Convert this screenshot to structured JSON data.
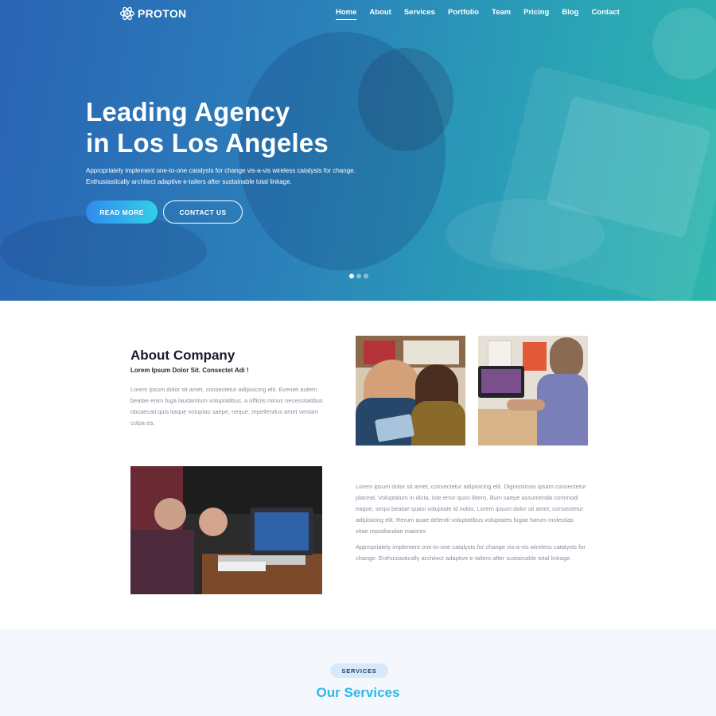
{
  "brand": {
    "name": "PROTON",
    "icon": "atom-icon"
  },
  "nav": {
    "items": [
      {
        "label": "Home",
        "active": true
      },
      {
        "label": "About",
        "active": false
      },
      {
        "label": "Services",
        "active": false
      },
      {
        "label": "Portfolio",
        "active": false
      },
      {
        "label": "Team",
        "active": false
      },
      {
        "label": "Pricing",
        "active": false
      },
      {
        "label": "Blog",
        "active": false
      },
      {
        "label": "Contact",
        "active": false
      }
    ]
  },
  "hero": {
    "title_line1": "Leading Agency",
    "title_line2": "in Los Los Angeles",
    "subtitle_line1": "Appropriately implement one-to-one catalysts for change vis-a-vis wireless catalysts for change.",
    "subtitle_line2": "Enthusiastically architect adaptive e-tailers after sustainable total linkage.",
    "primary_button": "READ MORE",
    "secondary_button": "CONTACT US",
    "slides": 3,
    "active_slide": 1
  },
  "about": {
    "title": "About Company",
    "subtitle": "Lorem Ipsum Dolor Sit. Consectet Adi !",
    "text": "Lorem ipsum dolor sit amet, consectetur adipisicing elit. Eveniet autem beatae enim fuga laudantium voluptatibus, a officiis minus necessitatibus obcaecati quis itaque voluptas saepe, neque, repellendus amet veniam culpa ea.",
    "detail_text1": "Lorem ipsum dolor sit amet, consectetur adipisicing elit. Dignissimos ipsam consectetur placeat. Voluptatum in dicta, iste error quos libero, illum saepe assumenda commodi eaque, sequi beatae quasi voluptate id nobis. Lorem ipsum dolor sit amet, consectetur adipisicing elit. Rerum quae deleniti voluptatibus voluptates fugiat harum molestias vitae repudiandae maiores",
    "detail_text2": "Appropriately implement one-to-one catalysts for change vis-a-vis wireless catalysts for change. Enthusiastically architect adaptive e-tailers after sustainable total linkage."
  },
  "services": {
    "badge": "SERVICES",
    "title": "Our Services"
  },
  "colors": {
    "hero_start": "#2a64b4",
    "hero_end": "#2fb6ad",
    "accent": "#2fb7ea",
    "button_start": "#2f8af0",
    "button_end": "#32d1e8"
  }
}
